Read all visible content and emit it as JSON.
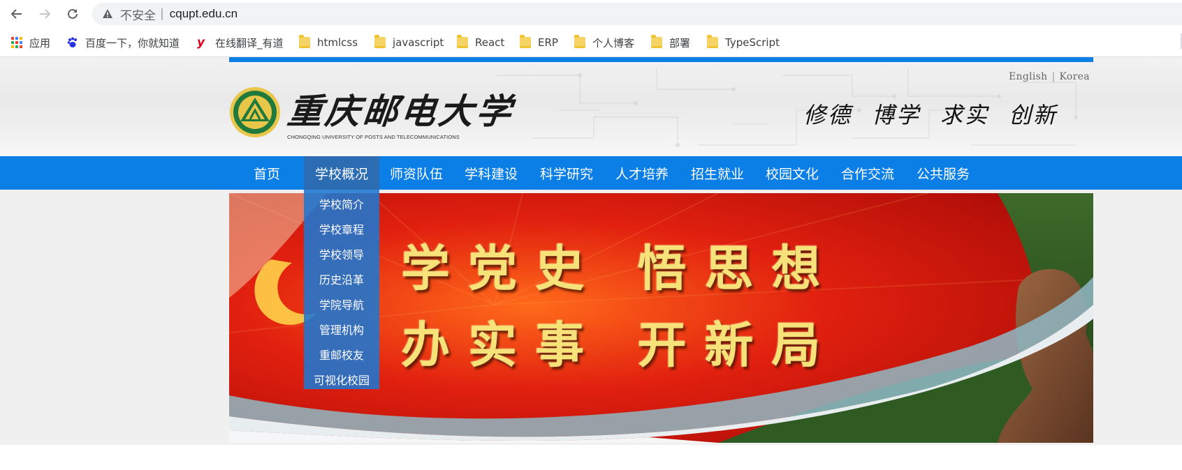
{
  "browser": {
    "back_icon": "arrow-left-icon",
    "forward_icon": "arrow-right-icon",
    "reload_icon": "reload-icon",
    "security_label": "不安全",
    "url": "cqupt.edu.cn"
  },
  "bookmarks": [
    {
      "label": "应用",
      "icon": "apps-grid-icon"
    },
    {
      "label": "百度一下，你就知道",
      "icon": "baidu-paw-icon"
    },
    {
      "label": "在线翻译_有道",
      "icon": "youdao-icon"
    },
    {
      "label": "htmlcss",
      "icon": "folder-icon"
    },
    {
      "label": "javascript",
      "icon": "folder-icon"
    },
    {
      "label": "React",
      "icon": "folder-icon"
    },
    {
      "label": "ERP",
      "icon": "folder-icon"
    },
    {
      "label": "个人博客",
      "icon": "folder-icon"
    },
    {
      "label": "部署",
      "icon": "folder-icon"
    },
    {
      "label": "TypeScript",
      "icon": "folder-icon"
    }
  ],
  "site": {
    "lang_english": "English",
    "lang_korea": "Korea",
    "name_cn": "重庆邮电大学",
    "name_en": "CHONGQING UNIVERSITY OF POSTS AND TELECOMMUNICATIONS",
    "motto": [
      "修德",
      "博学",
      "求实",
      "创新"
    ],
    "accent_color": "#0b7fe6"
  },
  "nav": [
    {
      "label": "首页"
    },
    {
      "label": "学校概况",
      "active": true
    },
    {
      "label": "师资队伍"
    },
    {
      "label": "学科建设"
    },
    {
      "label": "科学研究"
    },
    {
      "label": "人才培养"
    },
    {
      "label": "招生就业"
    },
    {
      "label": "校园文化"
    },
    {
      "label": "合作交流"
    },
    {
      "label": "公共服务"
    }
  ],
  "dropdown": [
    "学校简介",
    "学校章程",
    "学校领导",
    "历史沿革",
    "学院导航",
    "管理机构",
    "重邮校友",
    "可视化校园"
  ],
  "banner": {
    "line1": "学党史 悟思想",
    "line2": "办实事 开新局"
  }
}
